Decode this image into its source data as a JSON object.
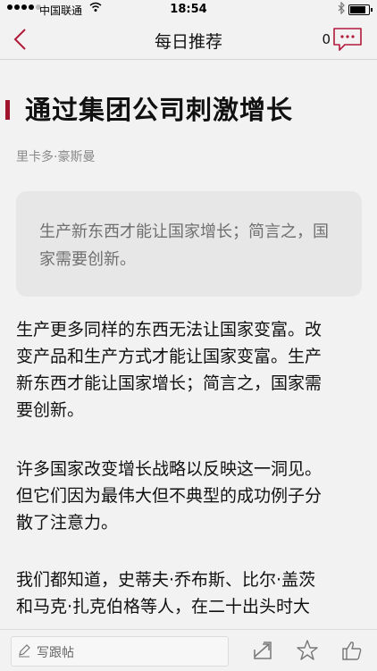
{
  "status_bar": {
    "carrier": "中国联通",
    "time": "18:54",
    "battery_level": 0.85,
    "icons": [
      "signal-dots",
      "wifi-icon",
      "bluetooth-icon",
      "battery-icon"
    ]
  },
  "nav": {
    "title": "每日推荐",
    "comment_count": "0",
    "icons": [
      "back-chevron-icon",
      "comment-bubble-icon"
    ],
    "accent_color": "#b11a3a"
  },
  "article": {
    "title": "通过集团公司刺激增长",
    "author": "里卡多·豪斯曼",
    "summary": "生产新东西才能让国家增长；简言之，国家需要创新。",
    "paragraphs": [
      {
        "lines": [
          "生产更多同样的东西无法让国家变富。改",
          "变产品和生产方式才能让国家变富。生产",
          "新东西才能让国家增长；简言之，国家需",
          "要创新。"
        ]
      },
      {
        "lines": [
          "许多国家改变增长战略以反映这一洞见。",
          "但它们因为最伟大但不典型的成功例子分",
          "散了注意力。"
        ]
      },
      {
        "lines": [
          "我们都知道，史蒂夫·乔布斯、比尔·盖茨",
          "和马克·扎克伯格等人，在二十出头时大"
        ]
      }
    ]
  },
  "toolbar": {
    "write_label": "写跟帖",
    "icons": [
      "pencil-icon",
      "share-icon",
      "star-icon",
      "thumbs-up-icon"
    ]
  }
}
